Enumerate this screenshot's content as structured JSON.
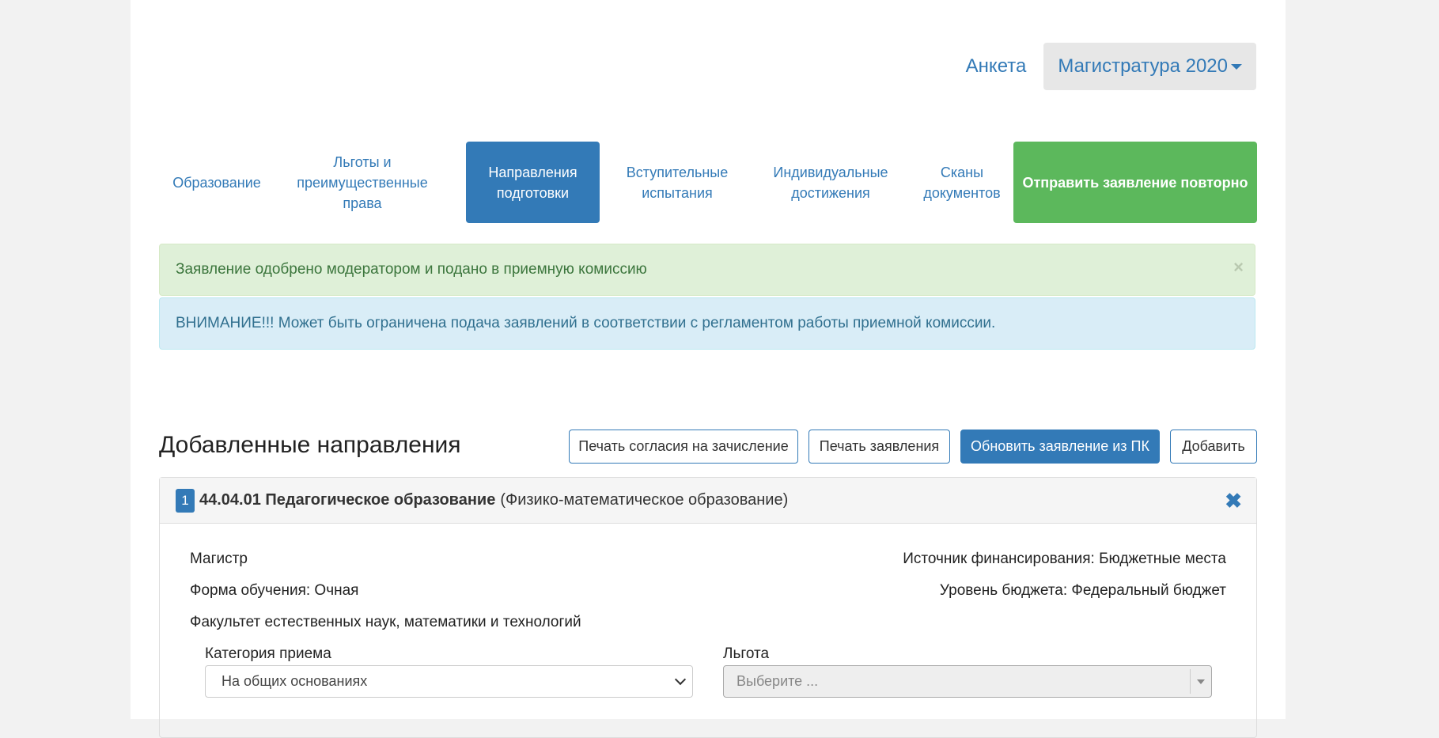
{
  "top_nav": {
    "link": "Анкета",
    "dropdown": "Магистратура 2020"
  },
  "steps": [
    {
      "label": "Образование"
    },
    {
      "label": "Льготы и преимущественные права"
    },
    {
      "label": "Направления подготовки"
    },
    {
      "label": "Вступительные испытания"
    },
    {
      "label": "Индивидуальные достижения"
    },
    {
      "label": "Сканы документов"
    }
  ],
  "send_again_button": "Отправить заявление повторно",
  "alerts": {
    "success": "Заявление одобрено модератором и подано в приемную комиссию",
    "close_symbol": "×",
    "info": "ВНИМАНИЕ!!! Может быть ограничена подача заявлений в соответствии с регламентом работы приемной комиссии."
  },
  "section": {
    "title": "Добавленные направления",
    "buttons": {
      "print_consent": "Печать согласия на зачисление",
      "print_application": "Печать заявления",
      "refresh": "Обновить заявление из ПК",
      "add": "Добавить"
    }
  },
  "direction": {
    "number": "1",
    "code_name": "44.04.01 Педагогическое образование",
    "profile": "(Физико-математическое образование)",
    "remove_symbol": "✖",
    "level": "Магистр",
    "study_form": "Форма обучения: Очная",
    "faculty": "Факультет естественных наук, математики и технологий",
    "funding_source": "Источник финансирования: Бюджетные места",
    "budget_level": "Уровень бюджета: Федеральный бюджет",
    "category_label": "Категория приема",
    "category_value": "На общих основаниях",
    "benefit_label": "Льгота",
    "benefit_placeholder": "Выберите ..."
  }
}
